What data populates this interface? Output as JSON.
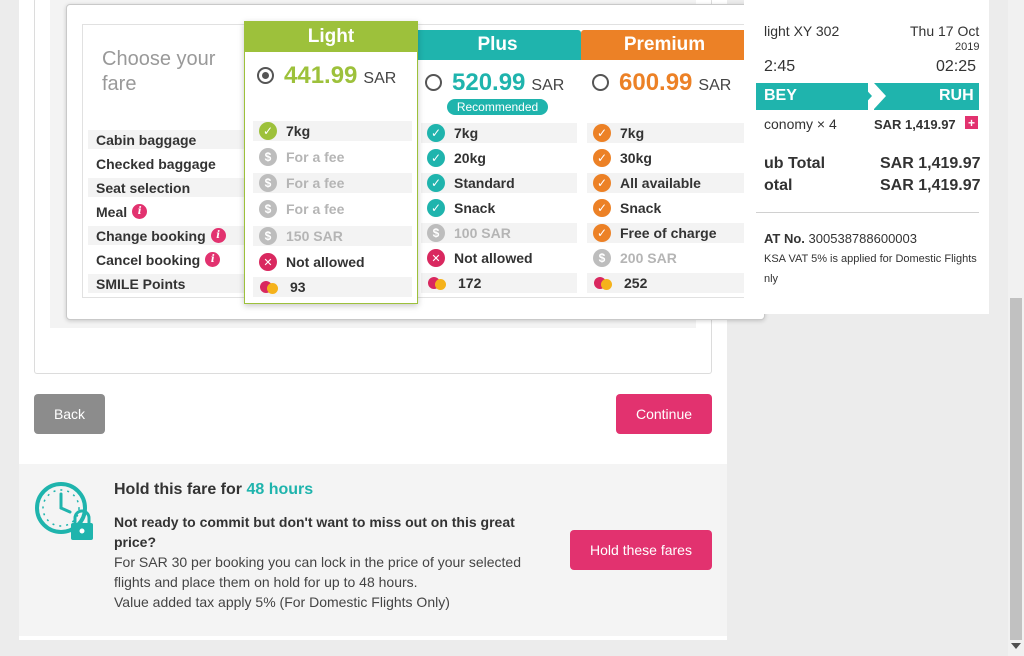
{
  "fare_table": {
    "choose_title": "Choose your fare",
    "rows": [
      {
        "label": "Cabin baggage",
        "info": false
      },
      {
        "label": "Checked baggage",
        "info": false
      },
      {
        "label": "Seat selection",
        "info": false
      },
      {
        "label": "Meal",
        "info": true
      },
      {
        "label": "Change booking",
        "info": true
      },
      {
        "label": "Cancel booking",
        "info": true
      },
      {
        "label": "SMILE Points",
        "info": false
      }
    ],
    "columns": {
      "light": {
        "name": "Light",
        "price": "441.99",
        "currency": "SAR",
        "color": "#9dc13b",
        "selected": true,
        "cells": [
          "7kg",
          "For a fee",
          "For a fee",
          "For a fee",
          "150 SAR",
          "Not allowed",
          "93"
        ],
        "icons": [
          "check-icon",
          "dollar-icon",
          "dollar-icon",
          "dollar-icon",
          "dollar-icon",
          "cross-icon",
          "smile-points-icon"
        ]
      },
      "plus": {
        "name": "Plus",
        "price": "520.99",
        "currency": "SAR",
        "color": "#1fb4ad",
        "selected": false,
        "badge": "Recommended",
        "cells": [
          "7kg",
          "20kg",
          "Standard",
          "Snack",
          "100 SAR",
          "Not allowed",
          "172"
        ],
        "icons": [
          "check-icon",
          "check-icon",
          "check-icon",
          "check-icon",
          "dollar-icon",
          "cross-icon",
          "smile-points-icon"
        ]
      },
      "premium": {
        "name": "Premium",
        "price": "600.99",
        "currency": "SAR",
        "color": "#ec8126",
        "selected": false,
        "cells": [
          "7kg",
          "30kg",
          "All available",
          "Snack",
          "Free of charge",
          "200 SAR",
          "252"
        ],
        "icons": [
          "check-icon",
          "check-icon",
          "check-icon",
          "check-icon",
          "check-icon",
          "dollar-icon",
          "smile-points-icon"
        ]
      }
    }
  },
  "nav": {
    "back_label": "Back",
    "continue_label": "Continue"
  },
  "hold": {
    "title_prefix": "Hold this fare for ",
    "title_accent": "48 hours",
    "lead": "Not ready to commit but don't want to miss out on this great price?",
    "body_line1": "For SAR 30 per booking you can lock in the price of your selected flights and place them on hold for up to 48 hours.",
    "body_line2": "Value added tax apply 5% (For Domestic Flights Only)",
    "button_label": "Hold these fares"
  },
  "summary": {
    "flight": "light XY 302",
    "date": "Thu 17 Oct",
    "year": "2019",
    "dep_time": "2:45",
    "arr_time": "02:25",
    "from": "BEY",
    "to": "RUH",
    "fare_line": "conomy × 4",
    "fare_amount": "SAR 1,419.97",
    "subtotal_label": "ub Total",
    "subtotal_amount": "SAR 1,419.97",
    "total_label": "otal",
    "total_amount": "SAR 1,419.97",
    "vat_label": "AT No.",
    "vat_number": "300538788600003",
    "vat_note_1": "KSA VAT 5% is applied for Domestic Flights",
    "vat_note_2": "nly"
  }
}
